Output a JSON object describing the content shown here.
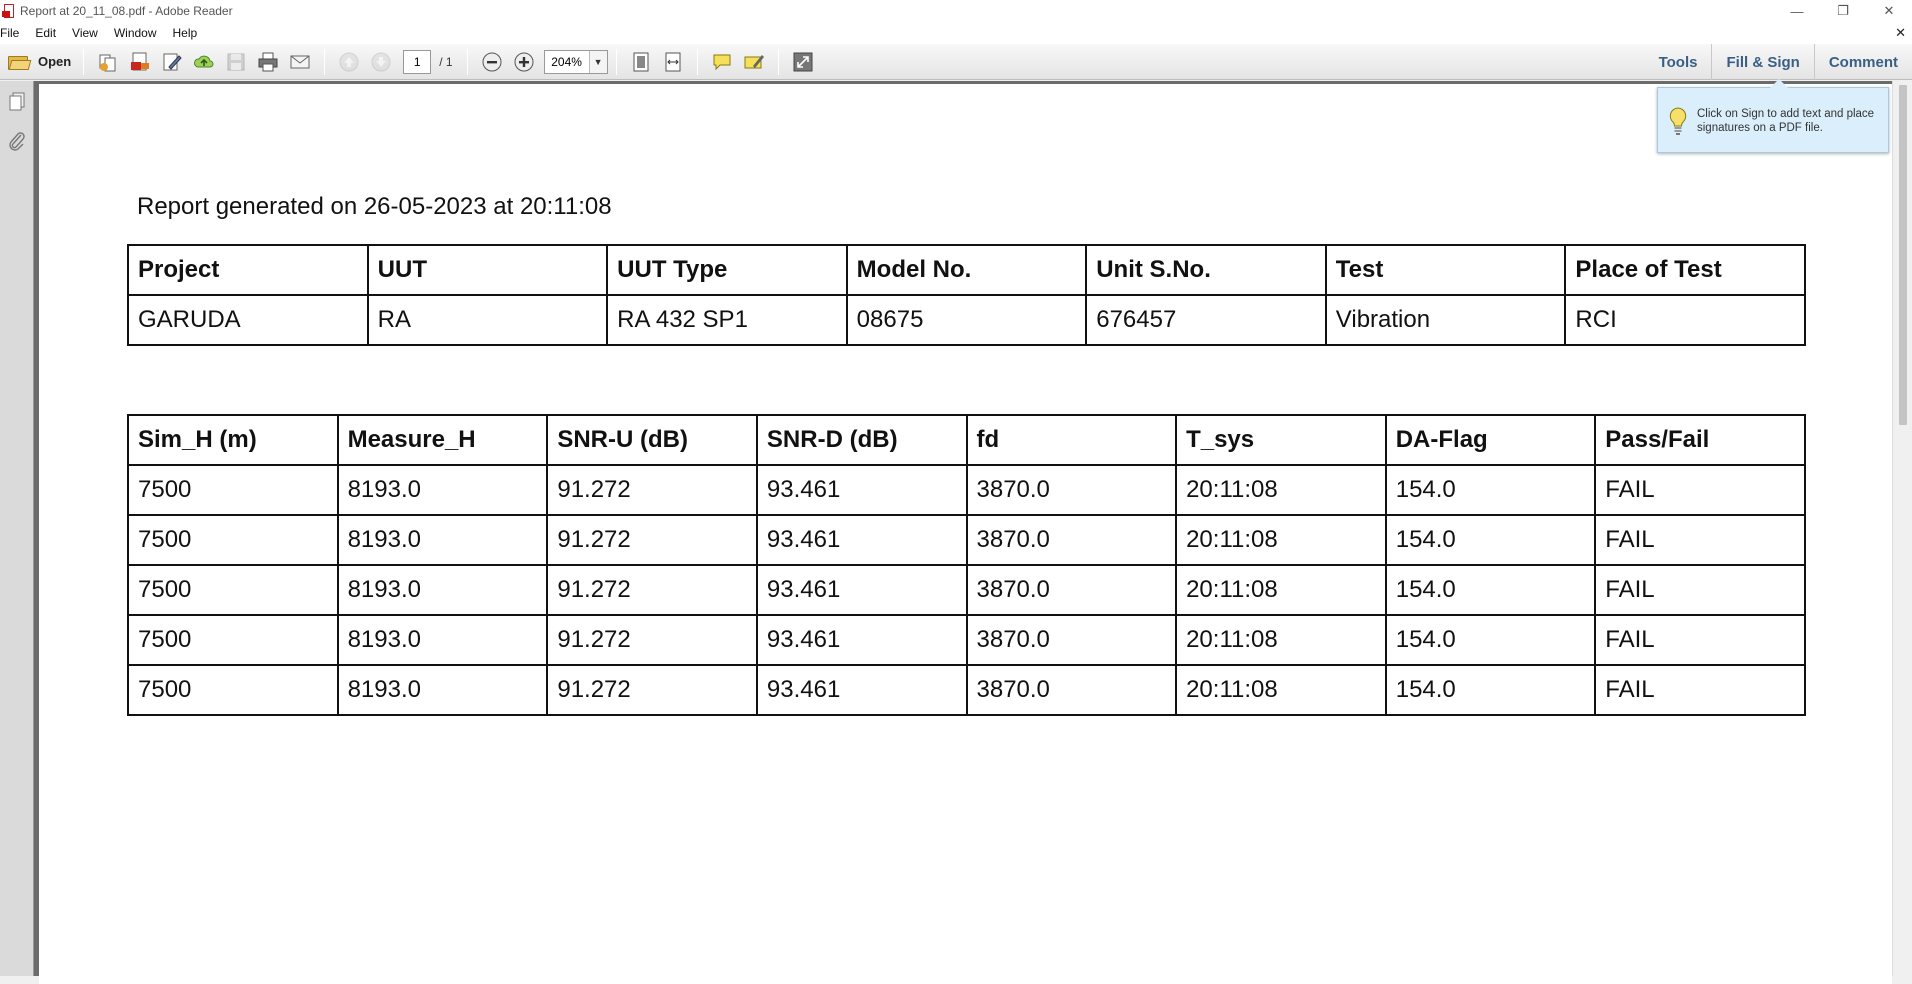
{
  "window": {
    "title": "Report at 20_11_08.pdf - Adobe Reader",
    "minimize_glyph": "—",
    "restore_glyph": "❐",
    "close_glyph": "✕",
    "doc_close_glyph": "✕"
  },
  "menu": [
    "File",
    "Edit",
    "View",
    "Window",
    "Help"
  ],
  "toolbar": {
    "open_label": "Open",
    "page_current": "1",
    "page_total": "/ 1",
    "zoom": "204%",
    "zoom_dropdown_glyph": "▼",
    "right_buttons": [
      "Tools",
      "Fill & Sign",
      "Comment"
    ]
  },
  "tooltip": {
    "text": "Click on Sign to add text and place signatures on a PDF file."
  },
  "document": {
    "report_line": "Report generated on 26-05-2023 at 20:11:08",
    "info_table": {
      "headers": [
        "Project",
        "UUT",
        "UUT Type",
        "Model No.",
        "Unit S.No.",
        "Test",
        "Place of Test"
      ],
      "row": [
        "GARUDA",
        "RA",
        "RA 432 SP1",
        "08675",
        "676457",
        "Vibration",
        "RCI"
      ]
    },
    "data_table": {
      "headers": [
        "Sim_H (m)",
        "Measure_H",
        "SNR-U (dB)",
        "SNR-D (dB)",
        "fd",
        "T_sys",
        "DA-Flag",
        "Pass/Fail"
      ],
      "rows": [
        [
          "7500",
          "8193.0",
          "91.272",
          "93.461",
          "3870.0",
          "20:11:08",
          "154.0",
          "FAIL"
        ],
        [
          "7500",
          "8193.0",
          "91.272",
          "93.461",
          "3870.0",
          "20:11:08",
          "154.0",
          "FAIL"
        ],
        [
          "7500",
          "8193.0",
          "91.272",
          "93.461",
          "3870.0",
          "20:11:08",
          "154.0",
          "FAIL"
        ],
        [
          "7500",
          "8193.0",
          "91.272",
          "93.461",
          "3870.0",
          "20:11:08",
          "154.0",
          "FAIL"
        ],
        [
          "7500",
          "8193.0",
          "91.272",
          "93.461",
          "3870.0",
          "20:11:08",
          "154.0",
          "FAIL"
        ]
      ]
    }
  }
}
